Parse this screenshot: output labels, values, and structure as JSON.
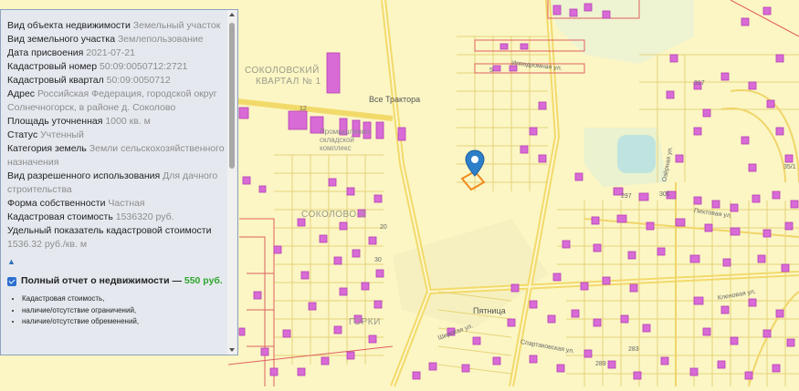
{
  "map": {
    "labels": {
      "quarter": "СОКОЛОВСКИЙ КВАРТАЛ № 1",
      "quarter_line1": "СОКОЛОВСКИЙ",
      "quarter_line2": "КВАРТАЛ № 1",
      "sokolovo": "СОКОЛОВО-2",
      "gorki": "ГОРКИ",
      "pyatnitsa": "Пятница",
      "vse_traktora": "Все Трактора",
      "complex": "Промышленно-складской комплекс",
      "complex_line1": "Промышленно-",
      "complex_line2": "складской",
      "complex_line3": "комплекс"
    },
    "streets": [
      "Ипподромная ул.",
      "Широкая ул.",
      "Спартаковская ул.",
      "Кленовая ул.",
      "Пихтовая ул.",
      "Озёрная ул."
    ],
    "house_numbers": [
      "317",
      "5",
      "20",
      "30",
      "297",
      "301",
      "35/1",
      "283",
      "289",
      "12"
    ],
    "colors": {
      "land": "#fbf6c4",
      "parcel_line": "#e8d77a",
      "building": "#d96bd6",
      "building_outline": "#b43fb3",
      "red_boundary": "#e05a5a",
      "green_area": "#e9f2d0",
      "pond": "#bde4e0",
      "selected_parcel": "#f08a1e",
      "marker": "#2c7fc8"
    }
  },
  "panel": {
    "rows": [
      {
        "key": "Вид объекта недвижимости",
        "value": "Земельный участок"
      },
      {
        "key": "Вид земельного участка",
        "value": "Землепользование"
      },
      {
        "key": "Дата присвоения",
        "value": "2021-07-21"
      },
      {
        "key": "Кадастровый номер",
        "value": "50:09:0050712:2721"
      },
      {
        "key": "Кадастровый квартал",
        "value": "50:09:0050712"
      },
      {
        "key": "Адрес",
        "value": "Российская Федерация, городской округ Солнечногорск, в районе д. Соколово"
      },
      {
        "key": "Площадь уточненная",
        "value": "1000 кв. м"
      },
      {
        "key": "Статус",
        "value": "Учтенный"
      },
      {
        "key": "Категория земель",
        "value": "Земли сельскохозяйственного назначения"
      },
      {
        "key": "Вид разрешенного использования",
        "value": "Для дачного строительства"
      },
      {
        "key": "Форма собственности",
        "value": "Частная"
      },
      {
        "key": "Кадастровая стоимость",
        "value": "1536320 руб."
      },
      {
        "key": "Удельный показатель кадастровой стоимости",
        "value": "1536.32 руб./кв. м"
      }
    ],
    "collapse_arrow": "▲",
    "order": {
      "checked": true,
      "title": "Полный отчет о недвижимости —",
      "price": "550 руб.",
      "features": [
        "Кадастровая стоимость,",
        "наличие/отсутствие ограничений,",
        "наличие/отсутствие обременений,"
      ]
    }
  }
}
